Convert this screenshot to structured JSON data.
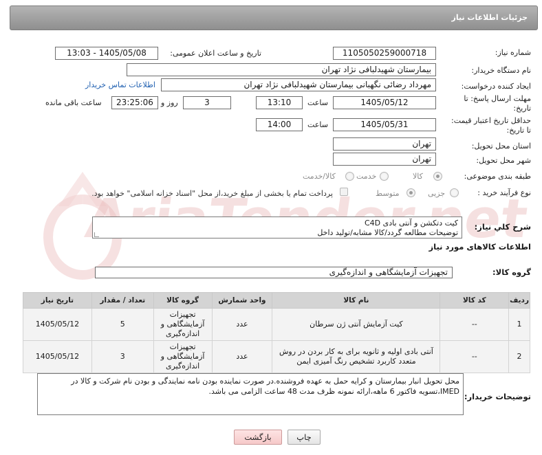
{
  "header": {
    "title": "جزئیات اطلاعات نیاز"
  },
  "form": {
    "need_number_label": "شماره نیاز:",
    "need_number": "1105050259000718",
    "announce_label": "تاریخ و ساعت اعلان عمومی:",
    "announce_value": "1405/05/08 - 13:03",
    "buyer_org_label": "نام دستگاه خریدار:",
    "buyer_org": "بیمارستان شهیدلبافی نژاد تهران",
    "requester_label": "ایجاد کننده درخواست:",
    "requester": "مهرداد رضائی نگهبانی بیمارستان شهیدلبافی نژاد تهران",
    "contact_link": "اطلاعات تماس خریدار",
    "deadline_label_1": "مهلت ارسال پاسخ: تا",
    "deadline_label_2": "تاریخ:",
    "deadline_date": "1405/05/12",
    "time_label": "ساعت",
    "deadline_time": "13:10",
    "days_value": "3",
    "days_label": "روز و",
    "remaining_time": "23:25:06",
    "remaining_label": "ساعت باقی مانده",
    "validity_label_1": "حداقل تاریخ اعتبار قیمت:",
    "validity_label_2": "تا تاریخ:",
    "validity_date": "1405/05/31",
    "validity_time_label": "ساعت",
    "validity_time": "14:00",
    "province_label": "استان محل تحویل:",
    "province": "تهران",
    "city_label": "شهر محل تحویل:",
    "city": "تهران",
    "category_label": "طبقه بندی موضوعی:",
    "category_options": [
      "کالا",
      "خدمت",
      "کالا/خدمت"
    ],
    "process_label": "نوع فرآیند خرید :",
    "process_options": [
      "جزیی",
      "متوسط"
    ],
    "payment_note": "پرداخت تمام یا بخشی از مبلغ خرید،از محل \"اسناد خزانه اسلامی\" خواهد بود."
  },
  "description": {
    "label": "شرح کلي نياز:",
    "line1": "کیت دتکشن و آنتی بادی C4D",
    "line2": "توضیحات مطالعه گردد/کالا مشابه/تولید داخل"
  },
  "goods": {
    "section_title": "اطلاعات کالاهای مورد نیاز",
    "group_label": "گروه کالا:",
    "group_value": "تجهیزات آزمایشگاهی و اندازه‌گیری"
  },
  "table": {
    "headers": [
      "ردیف",
      "کد کالا",
      "نام کالا",
      "واحد شمارش",
      "گروه کالا",
      "تعداد / مقدار",
      "تاریخ نیاز"
    ],
    "rows": [
      [
        "1",
        "--",
        "کیت آزمایش آنتی ژن سرطان",
        "عدد",
        "تجهیزات آزمایشگاهی و اندازه‌گیری",
        "5",
        "1405/05/12"
      ],
      [
        "2",
        "--",
        "آنتی بادی اولیه و ثانویه برای به کار بردن در روش متعدد کاربرد تشخیص رنگ آمیزی ایمن",
        "عدد",
        "تجهیزات آزمایشگاهی و اندازه‌گیری",
        "3",
        "1405/05/12"
      ]
    ]
  },
  "buyer_notes": {
    "label": "توضیحات خریدار:",
    "text": "محل تحویل انبار بیمارستان و کرایه حمل به عهده فروشنده.در صورت نماینده بودن نامه نمایندگی و بودن نام شرکت و کالا در IMED،تسویه فاکتور 6 ماهه،ارائه نمونه ظرف مدت 48 ساعت الزامی می باشد."
  },
  "buttons": {
    "print": "چاپ",
    "back": "بازگشت"
  },
  "watermark": {
    "text": "AriaTender.net"
  },
  "colors": {
    "header_bg": "#9e9e9e",
    "link": "#1f5fb0",
    "table_head": "#d4d4d4",
    "back_btn": "#f6c9c9"
  }
}
